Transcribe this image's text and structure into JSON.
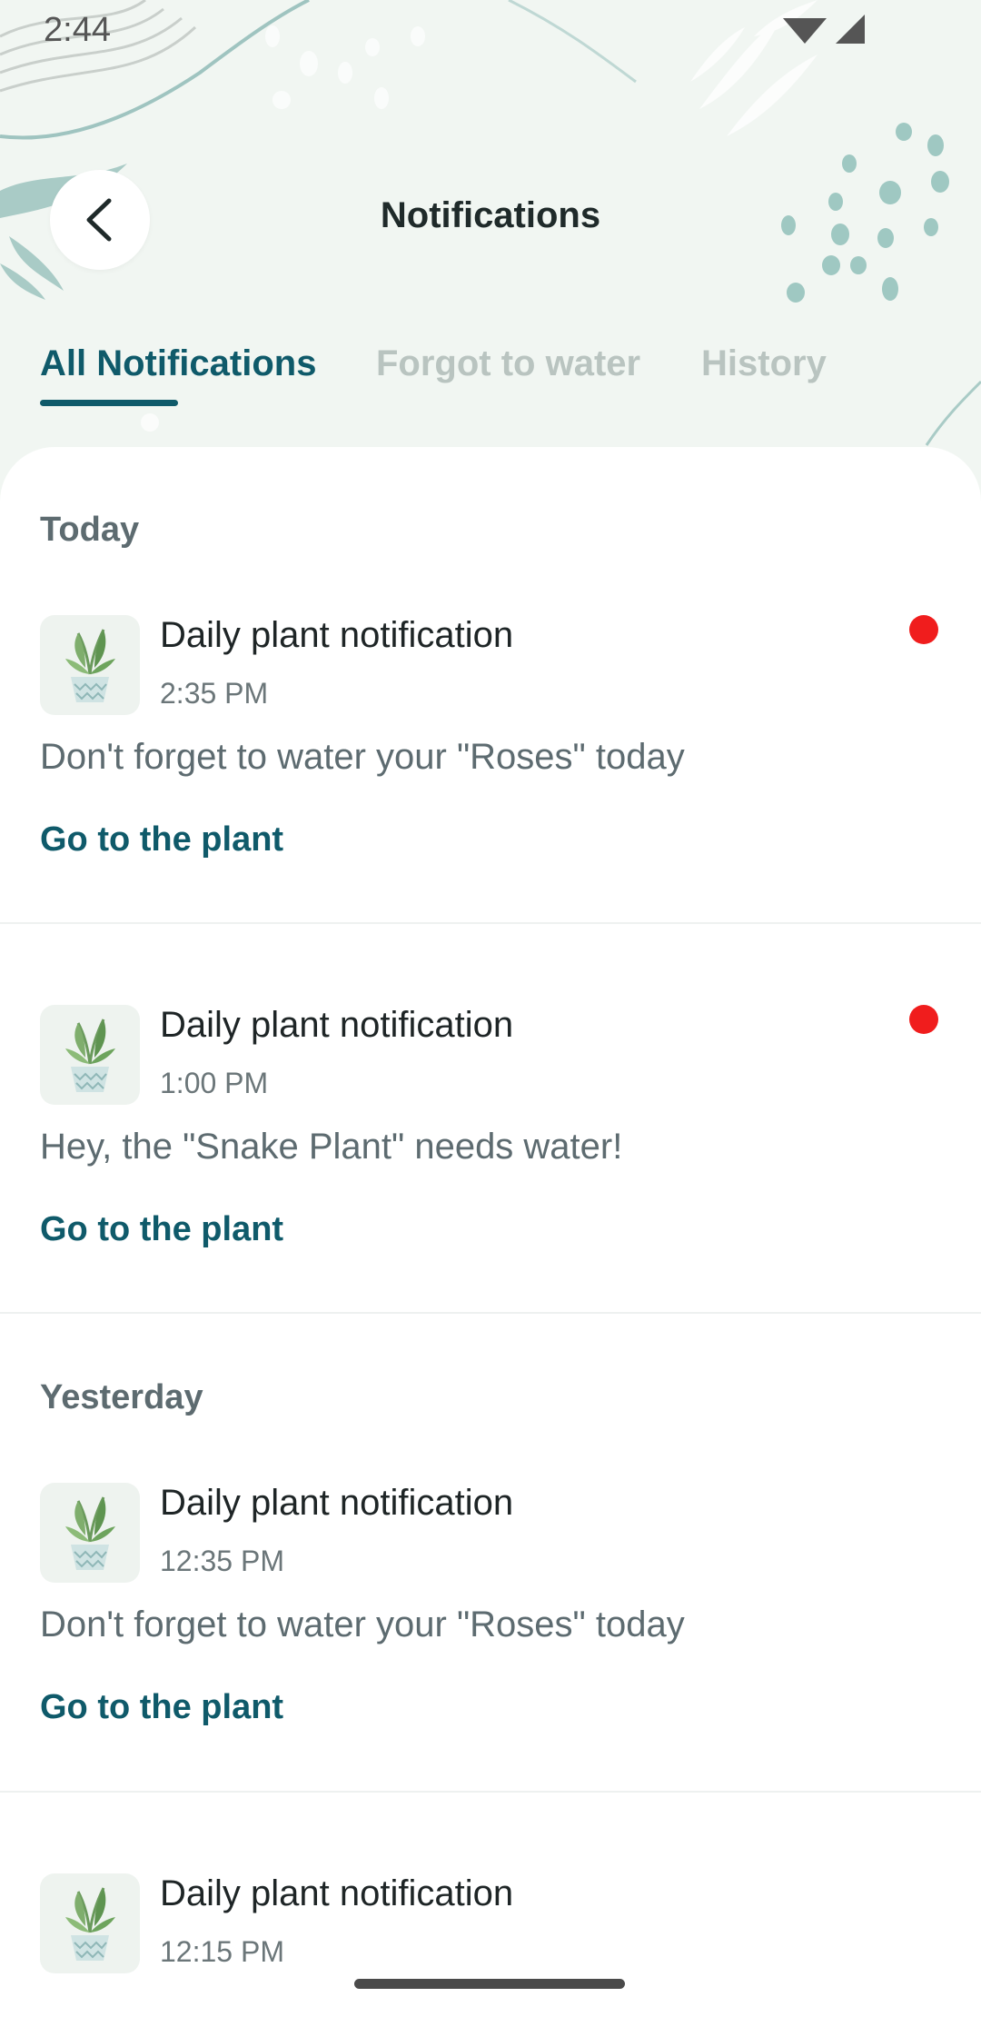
{
  "status_bar": {
    "time": "2:44"
  },
  "header": {
    "title": "Notifications"
  },
  "tabs": [
    {
      "label": "All Notifications",
      "active": true
    },
    {
      "label": "Forgot to water",
      "active": false
    },
    {
      "label": "History",
      "active": false
    }
  ],
  "sections": [
    {
      "title": "Today",
      "notifications": [
        {
          "title": "Daily plant notification",
          "time": "2:35 PM",
          "body": "Don't forget to water your \"Roses\" today",
          "action": "Go to the plant",
          "unread": true
        },
        {
          "title": "Daily plant notification",
          "time": "1:00 PM",
          "body": "Hey, the \"Snake Plant\" needs water!",
          "action": "Go to the plant",
          "unread": true
        }
      ]
    },
    {
      "title": "Yesterday",
      "notifications": [
        {
          "title": "Daily plant notification",
          "time": "12:35 PM",
          "body": "Don't forget to water your \"Roses\" today",
          "action": "Go to the plant",
          "unread": false
        },
        {
          "title": "Daily plant notification",
          "time": "12:15 PM",
          "body": "",
          "action": "",
          "unread": false
        }
      ]
    }
  ],
  "colors": {
    "accent": "#0f5a6a",
    "background": "#f1f6f2",
    "unread_dot": "#f01d1d",
    "muted_tab": "#b9c4c0"
  },
  "icons": {
    "back": "chevron-left-icon",
    "plant": "potted-plant-icon",
    "wifi": "wifi-icon",
    "signal": "cell-signal-icon"
  }
}
